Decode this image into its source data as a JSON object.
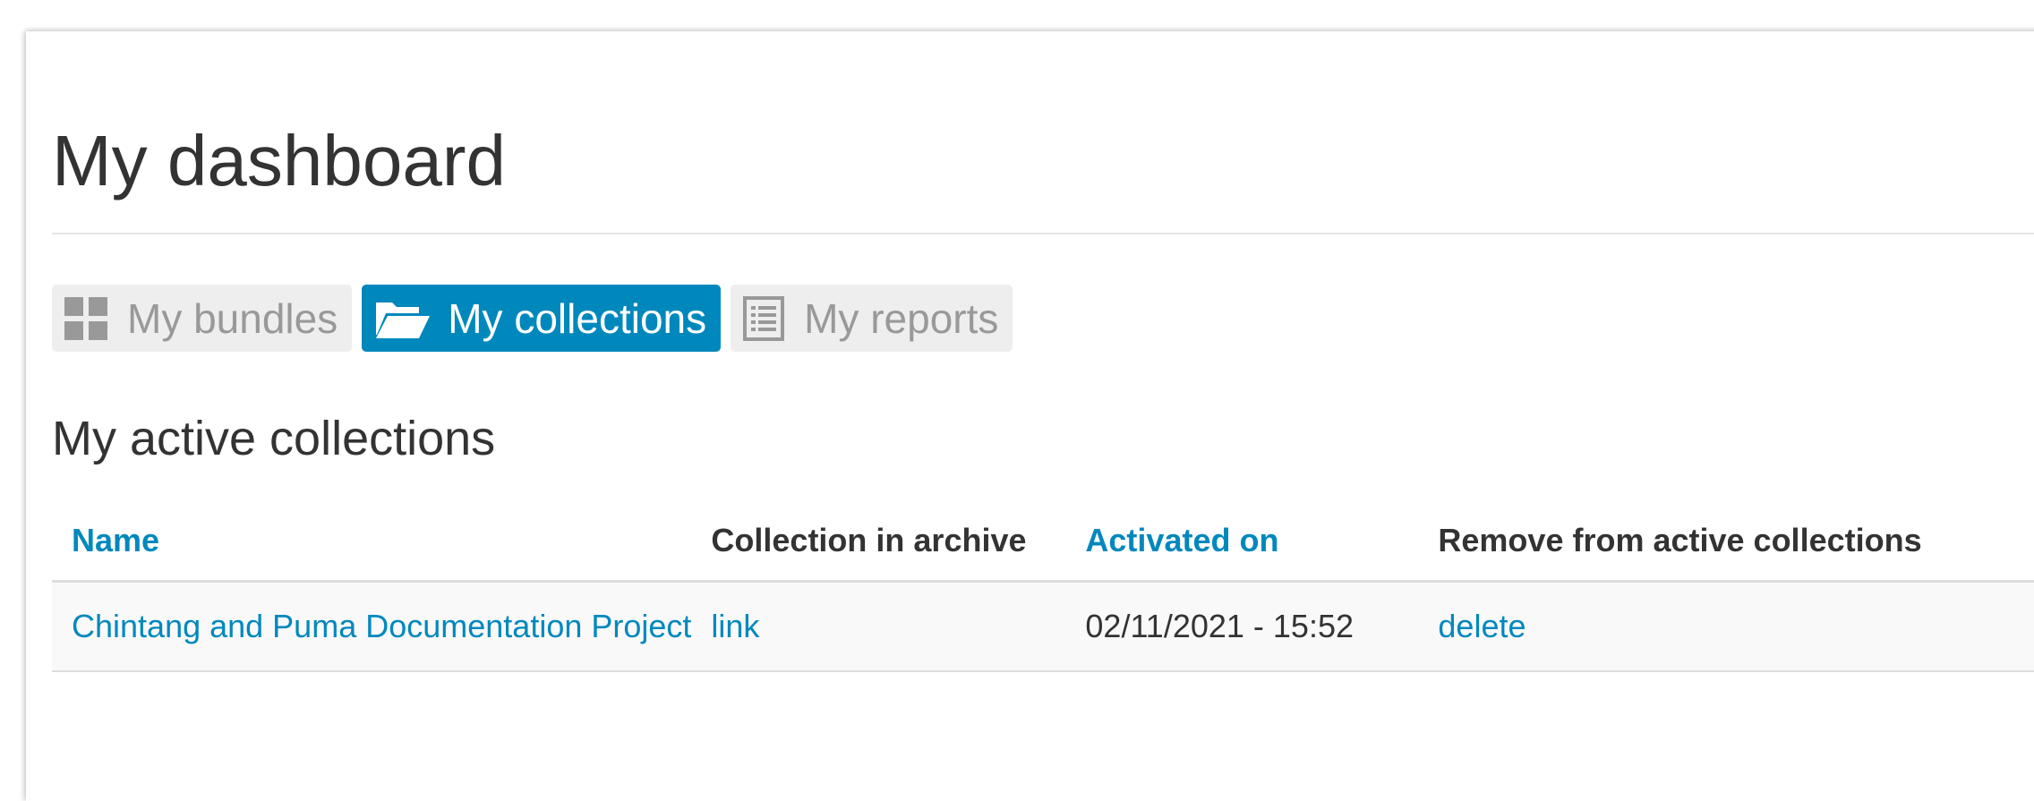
{
  "page": {
    "title": "My dashboard"
  },
  "tabs": [
    {
      "label": "My bundles",
      "icon": "grid-icon",
      "active": false
    },
    {
      "label": "My collections",
      "icon": "folder-open-icon",
      "active": true
    },
    {
      "label": "My reports",
      "icon": "list-icon",
      "active": false
    }
  ],
  "section": {
    "title": "My active collections"
  },
  "table": {
    "headers": [
      {
        "label": "Name",
        "sortable": true
      },
      {
        "label": "Collection in archive",
        "sortable": false
      },
      {
        "label": "Activated on",
        "sortable": true
      },
      {
        "label": "Remove from active collections",
        "sortable": false
      }
    ],
    "rows": [
      {
        "name": "Chintang and Puma Documentation Project",
        "archive_link": "link",
        "activated_on": "02/11/2021 - 15:52",
        "remove_link": "delete"
      }
    ]
  },
  "colors": {
    "accent": "#0088bd",
    "tab_inactive_bg": "#eeeeee",
    "tab_inactive_text": "#999999",
    "text": "#333333"
  }
}
